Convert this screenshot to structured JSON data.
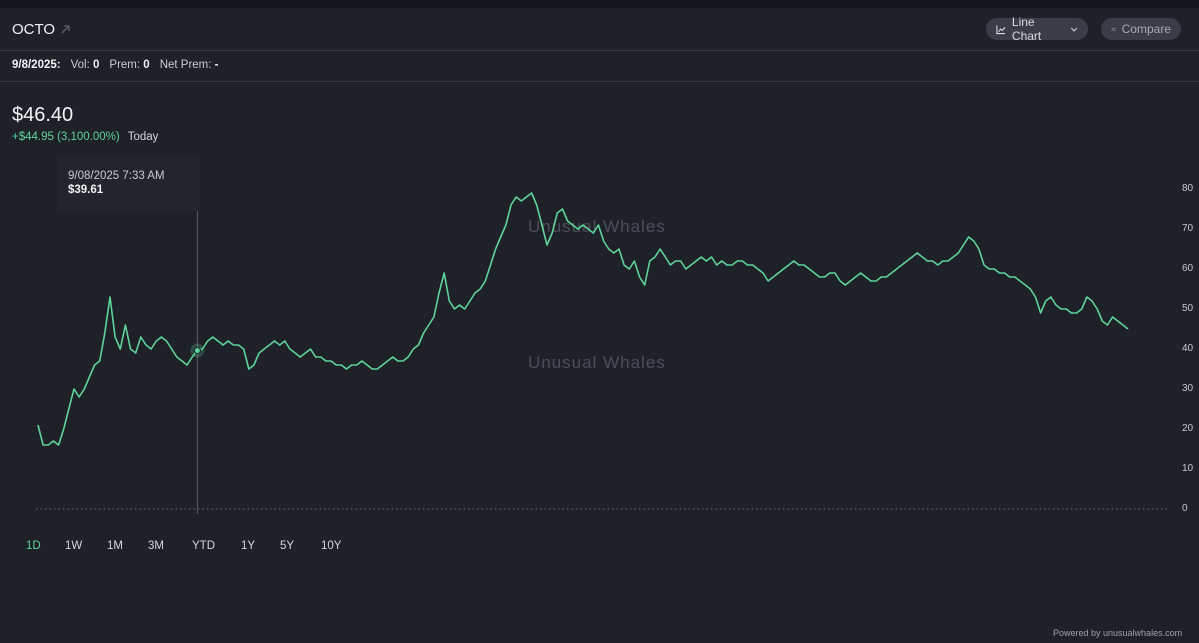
{
  "header": {
    "ticker": "OCTO",
    "chart_type_label": "Line Chart",
    "compare_label": "Compare"
  },
  "stats": {
    "date_label": "9/8/2025:",
    "vol_label": "Vol:",
    "vol_value": "0",
    "prem_label": "Prem:",
    "prem_value": "0",
    "net_prem_label": "Net Prem:",
    "net_prem_value": "-"
  },
  "price": {
    "value": "$46.40",
    "change": "+$44.95 (3,100.00%)",
    "period": "Today"
  },
  "tooltip": {
    "datetime": "9/08/2025 7:33 AM",
    "price": "$39.61"
  },
  "watermark": "Unusual Whales",
  "ranges": [
    "1D",
    "1W",
    "1M",
    "3M",
    "YTD",
    "1Y",
    "5Y",
    "10Y"
  ],
  "active_range": "1D",
  "footer": {
    "powered": "Powered by unusualwhales.com"
  },
  "colors": {
    "background": "#1f2128",
    "line": "#5ed39a",
    "positive": "#5ed39a"
  },
  "chart_data": {
    "type": "line",
    "ylim": [
      0,
      80
    ],
    "yticks": [
      0,
      10,
      20,
      30,
      40,
      50,
      60,
      70,
      80
    ],
    "grid": false,
    "series": [
      {
        "values": [
          21,
          16,
          16,
          17,
          16,
          20,
          25,
          30,
          28,
          30,
          33,
          36,
          37,
          44,
          53,
          43,
          40,
          46,
          40,
          39,
          43,
          41,
          40,
          42,
          43,
          42,
          40,
          38,
          37,
          36,
          38,
          39.61,
          40,
          42,
          43,
          42,
          41,
          42,
          41,
          41,
          40,
          35,
          36,
          39,
          40,
          41,
          42,
          41,
          42,
          40,
          39,
          38,
          39,
          40,
          38,
          38,
          37,
          37,
          36,
          36,
          35,
          36,
          36,
          37,
          36,
          35,
          35,
          36,
          37,
          38,
          37,
          37,
          38,
          40,
          41,
          44,
          46,
          48,
          54,
          59,
          52,
          50,
          51,
          50,
          52,
          54,
          55,
          57,
          61,
          65,
          68,
          71,
          76,
          78,
          77,
          78,
          79,
          76,
          71,
          66,
          69,
          74,
          75,
          72,
          71,
          70,
          71,
          70,
          69,
          71,
          67,
          65,
          64,
          65,
          61,
          60,
          62,
          58,
          56,
          62,
          63,
          65,
          63,
          61,
          62,
          62,
          60,
          61,
          62,
          63,
          62,
          63,
          61,
          62,
          61,
          61,
          62,
          62,
          61,
          61,
          60,
          59,
          57,
          58,
          59,
          60,
          61,
          62,
          61,
          61,
          60,
          59,
          58,
          58,
          59,
          59,
          57,
          56,
          57,
          58,
          59,
          58,
          57,
          57,
          58,
          58,
          59,
          60,
          61,
          62,
          63,
          64,
          63,
          62,
          62,
          61,
          62,
          62,
          63,
          64,
          66,
          68,
          67,
          65,
          61,
          60,
          60,
          59,
          59,
          58,
          58,
          57,
          56,
          55,
          53,
          49,
          52,
          53,
          51,
          50,
          50,
          49,
          49,
          50,
          53,
          52,
          50,
          47,
          46,
          48,
          47,
          46,
          45
        ]
      }
    ],
    "cursor_index": 31
  }
}
